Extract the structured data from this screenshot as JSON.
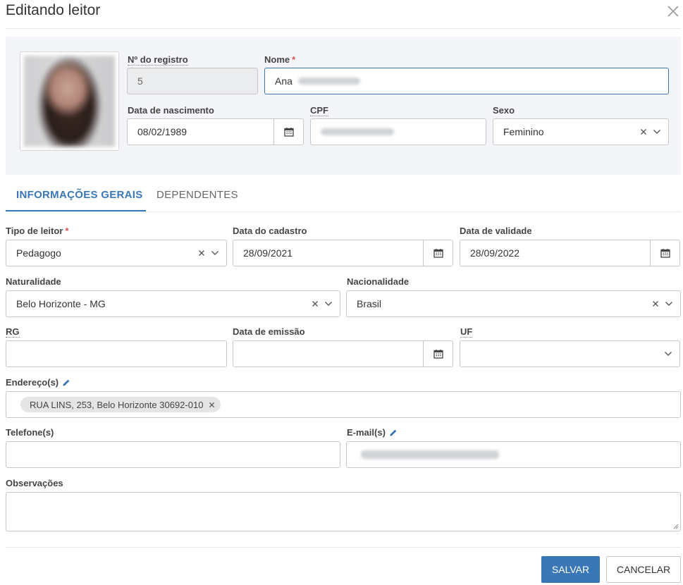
{
  "dialog": {
    "title": "Editando leitor"
  },
  "header": {
    "registro": {
      "label": "Nº do registro",
      "value": "5"
    },
    "nome": {
      "label": "Nome",
      "required_mark": "*",
      "value": "Ana"
    },
    "nascimento": {
      "label": "Data de nascimento",
      "value": "08/02/1989"
    },
    "cpf": {
      "label": "CPF"
    },
    "sexo": {
      "label": "Sexo",
      "value": "Feminino"
    }
  },
  "tabs": [
    {
      "label": "INFORMAÇÕES GERAIS",
      "active": true
    },
    {
      "label": "DEPENDENTES",
      "active": false
    }
  ],
  "form": {
    "tipo_leitor": {
      "label": "Tipo de leitor",
      "required_mark": "*",
      "value": "Pedagogo"
    },
    "data_cadastro": {
      "label": "Data do cadastro",
      "value": "28/09/2021"
    },
    "data_validade": {
      "label": "Data de validade",
      "value": "28/09/2022"
    },
    "naturalidade": {
      "label": "Naturalidade",
      "value": "Belo Horizonte - MG"
    },
    "nacionalidade": {
      "label": "Nacionalidade",
      "value": "Brasil"
    },
    "rg": {
      "label": "RG",
      "value": ""
    },
    "data_emissao": {
      "label": "Data de emissão",
      "value": ""
    },
    "uf": {
      "label": "UF",
      "value": ""
    },
    "enderecos": {
      "label": "Endereço(s)",
      "chips": [
        "RUA LINS, 253, Belo Horizonte 30692-010"
      ]
    },
    "telefones": {
      "label": "Telefone(s)",
      "value": ""
    },
    "emails": {
      "label": "E-mail(s)"
    },
    "observacoes": {
      "label": "Observações",
      "value": ""
    }
  },
  "footer": {
    "save_label": "SALVAR",
    "cancel_label": "CANCELAR"
  },
  "colors": {
    "primary": "#3a77b6",
    "required": "#d9534f",
    "panel_bg": "#f3f5f8",
    "disabled_bg": "#ebeced"
  },
  "icons": [
    "close-icon",
    "calendar-icon",
    "clear-icon",
    "chevron-down-icon",
    "pencil-icon",
    "resize-grip-icon"
  ]
}
